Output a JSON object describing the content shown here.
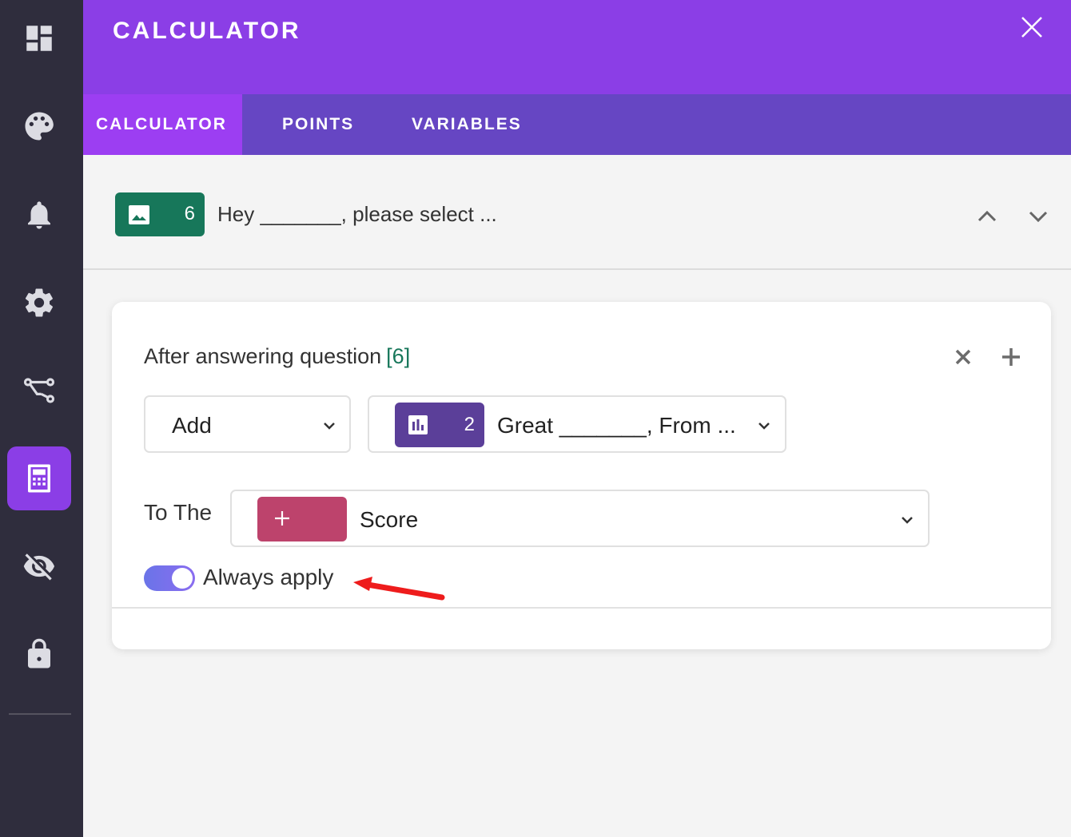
{
  "sidebar": {
    "items": [
      {
        "name": "dashboard-icon"
      },
      {
        "name": "palette-icon"
      },
      {
        "name": "bell-icon"
      },
      {
        "name": "gear-icon"
      },
      {
        "name": "workflow-icon"
      },
      {
        "name": "calculator-icon",
        "active": true
      },
      {
        "name": "eye-off-icon"
      },
      {
        "name": "lock-icon"
      }
    ]
  },
  "header": {
    "title": "CALCULATOR"
  },
  "tabs": [
    {
      "label": "CALCULATOR",
      "active": true
    },
    {
      "label": "POINTS"
    },
    {
      "label": "VARIABLES"
    }
  ],
  "question": {
    "number": "6",
    "text": "Hey _______, please select ..."
  },
  "rule": {
    "title": "After answering question",
    "question_ref": "[6]",
    "operation": "Add",
    "source_number": "2",
    "source_text": "Great _______, From ...",
    "target_prefix": "To The",
    "target_label": "Score",
    "always_apply_label": "Always apply",
    "always_apply": true
  },
  "colors": {
    "brand": "#8b3ee6",
    "tab_bar": "#6646c3",
    "question_badge": "#17775a",
    "source_badge": "#5b3f99",
    "score_badge": "#bd436c"
  }
}
